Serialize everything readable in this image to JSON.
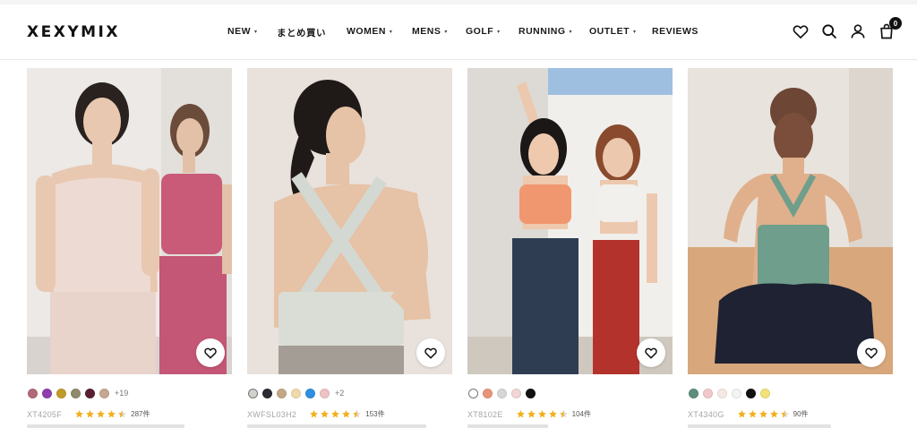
{
  "brand": {
    "logo": "XEXYMIX"
  },
  "nav": {
    "items": [
      {
        "label": "NEW",
        "caret": "▾"
      },
      {
        "label": "まとめ買い",
        "caret": ""
      },
      {
        "label": "WOMEN",
        "caret": "▾"
      },
      {
        "label": "MENS",
        "caret": "▾"
      },
      {
        "label": "GOLF",
        "caret": "▾"
      },
      {
        "label": "RUNNING",
        "caret": "▾"
      },
      {
        "label": "OUTLET",
        "caret": "▾"
      },
      {
        "label": "REVIEWS",
        "caret": ""
      }
    ]
  },
  "header_icons": {
    "wishlist": "heart-icon",
    "search": "search-icon",
    "account": "user-icon",
    "cart": "shopping-bag-icon",
    "cart_count": "0"
  },
  "products": [
    {
      "code": "XT4205F",
      "rating": 4.5,
      "reviews": "287件",
      "swatches": [
        "#b06a78",
        "#8e3fae",
        "#c29b2a",
        "#8f8a6c",
        "#5a1f31",
        "#c7a692"
      ],
      "more_colors": "+19",
      "image": "two-models-sleeveless-tops-icon"
    },
    {
      "code": "XWFSL03H2",
      "rating": 4.5,
      "reviews": "153件",
      "swatches": [
        "#d3d1cb",
        "#2b2b33",
        "#c4a786",
        "#f1d9ad",
        "#2f8fe0",
        "#eec3c3"
      ],
      "more_colors": "+2",
      "image": "model-cross-back-top-icon"
    },
    {
      "code": "XT8102E",
      "rating": 4.5,
      "reviews": "104件",
      "swatches": [
        "#ffffff",
        "#e7957a",
        "#d7d7d7",
        "#f0d6d6",
        "#111111"
      ],
      "more_colors": "",
      "image": "two-models-bra-tops-icon"
    },
    {
      "code": "XT4340G",
      "rating": 4.5,
      "reviews": "90件",
      "swatches": [
        "#5e8f7a",
        "#f0c9c9",
        "#f6e9e3",
        "#f3f3f3",
        "#111111",
        "#f2e27a"
      ],
      "more_colors": "",
      "image": "model-racerback-top-seated-icon"
    }
  ]
}
